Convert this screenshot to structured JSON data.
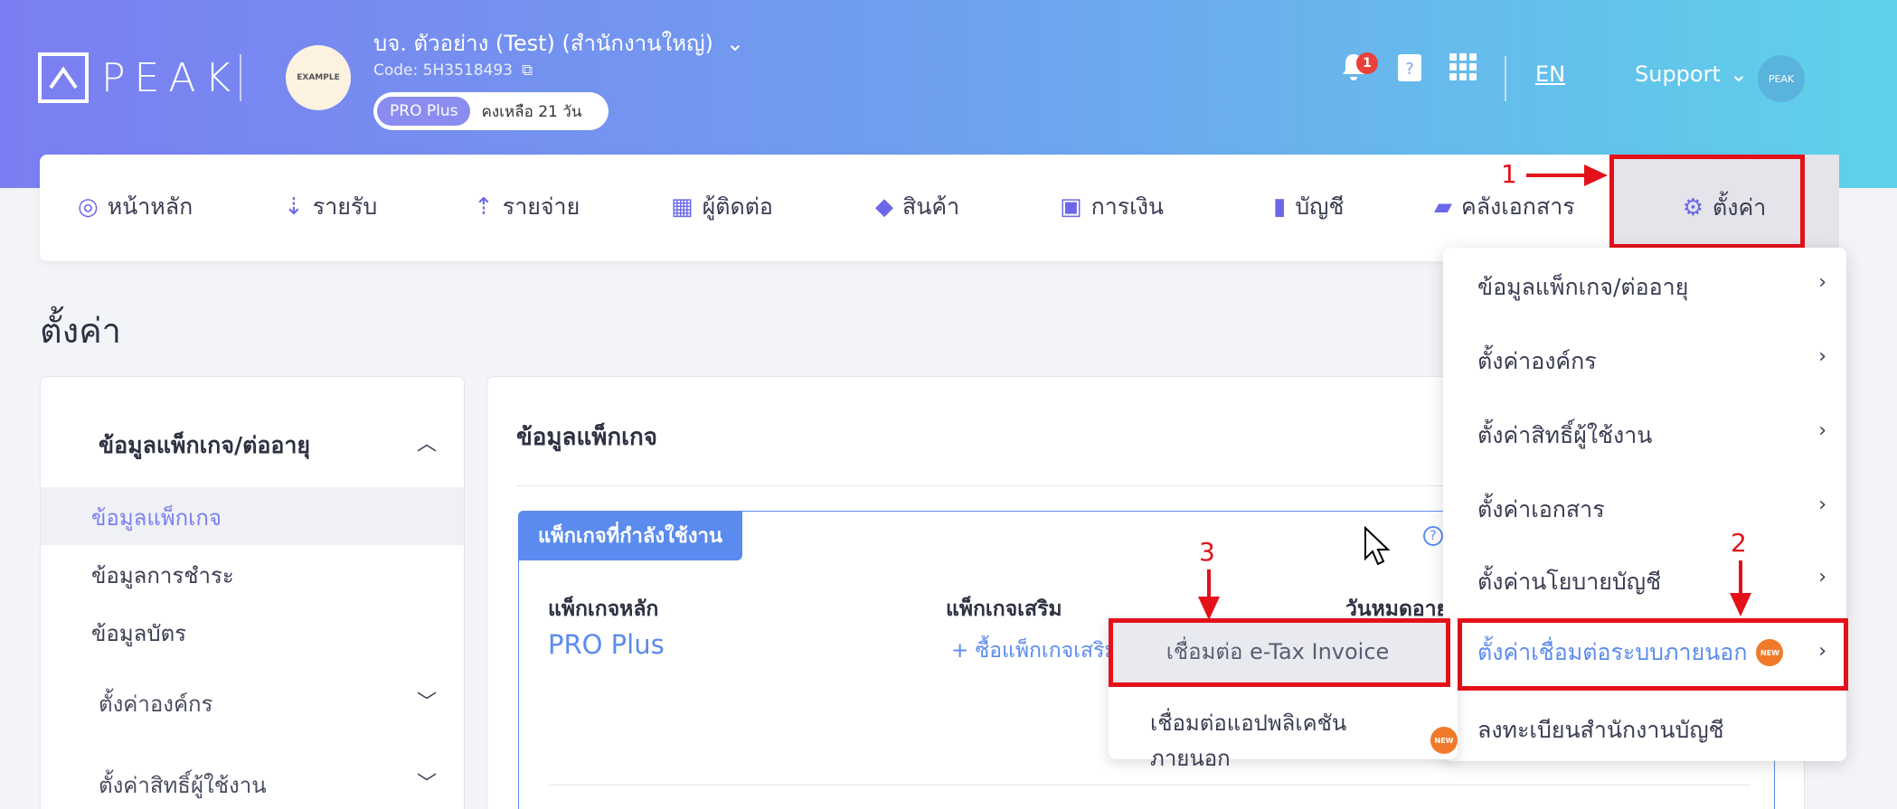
{
  "header": {
    "logo_text": "PEAK",
    "company_name": "บจ. ตัวอย่าง (Test) (สำนักงานใหญ่)",
    "company_code": "Code: 5H3518493",
    "company_avatar_text": "EXAMPLE",
    "plan_badge": "PRO Plus",
    "plan_days": "คงเหลือ 21 วัน",
    "notification_count": "1",
    "language": "EN",
    "support_label": "Support",
    "user_avatar_text": "PEAK"
  },
  "nav": {
    "items": [
      {
        "label": "หน้าหลัก",
        "icon": "dashboard-icon"
      },
      {
        "label": "รายรับ",
        "icon": "income-icon"
      },
      {
        "label": "รายจ่าย",
        "icon": "expense-icon"
      },
      {
        "label": "ผู้ติดต่อ",
        "icon": "contacts-icon"
      },
      {
        "label": "สินค้า",
        "icon": "product-box-icon"
      },
      {
        "label": "การเงิน",
        "icon": "money-icon"
      },
      {
        "label": "บัญชี",
        "icon": "ledger-icon"
      },
      {
        "label": "คลังเอกสาร",
        "icon": "folder-icon"
      },
      {
        "label": "ตั้งค่า",
        "icon": "gear-icon"
      }
    ]
  },
  "page": {
    "title": "ตั้งค่า"
  },
  "sidebar": {
    "section_title": "ข้อมูลแพ็กเกจ/ต่ออายุ",
    "items": [
      "ข้อมูลแพ็กเกจ",
      "ข้อมูลการชำระ",
      "ข้อมูลบัตร"
    ],
    "groups": [
      "ตั้งค่าองค์กร",
      "ตั้งค่าสิทธิ์ผู้ใช้งาน"
    ]
  },
  "main": {
    "title": "ข้อมูลแพ็กเกจ",
    "card_tab": "แพ็กเกจที่กำลังใช้งาน",
    "main_package_label": "แพ็กเกจหลัก",
    "main_package_value": "PRO Plus",
    "addon_label": "แพ็กเกจเสริม",
    "addon_buy": "+ ซื้อแพ็กเกจเสริม",
    "expiry_label": "วันหมดอายุ"
  },
  "settings_menu": {
    "items": [
      "ข้อมูลแพ็กเกจ/ต่ออายุ",
      "ตั้งค่าองค์กร",
      "ตั้งค่าสิทธิ์ผู้ใช้งาน",
      "ตั้งค่าเอกสาร",
      "ตั้งค่านโยบายบัญชี",
      "ตั้งค่าเชื่อมต่อระบบภายนอก",
      "ลงทะเบียนสำนักงานบัญชี"
    ],
    "new_badge": "NEW"
  },
  "submenu": {
    "items": [
      "เชื่อมต่อ e-Tax Invoice",
      "เชื่อมต่อแอปพลิเคชันภายนอก"
    ]
  },
  "annotations": [
    "1",
    "2",
    "3"
  ],
  "colors": {
    "accent": "#7b7ef2",
    "primary_blue": "#5b8bee",
    "annotation_red": "#e4111a",
    "new_badge": "#f07a2a"
  }
}
